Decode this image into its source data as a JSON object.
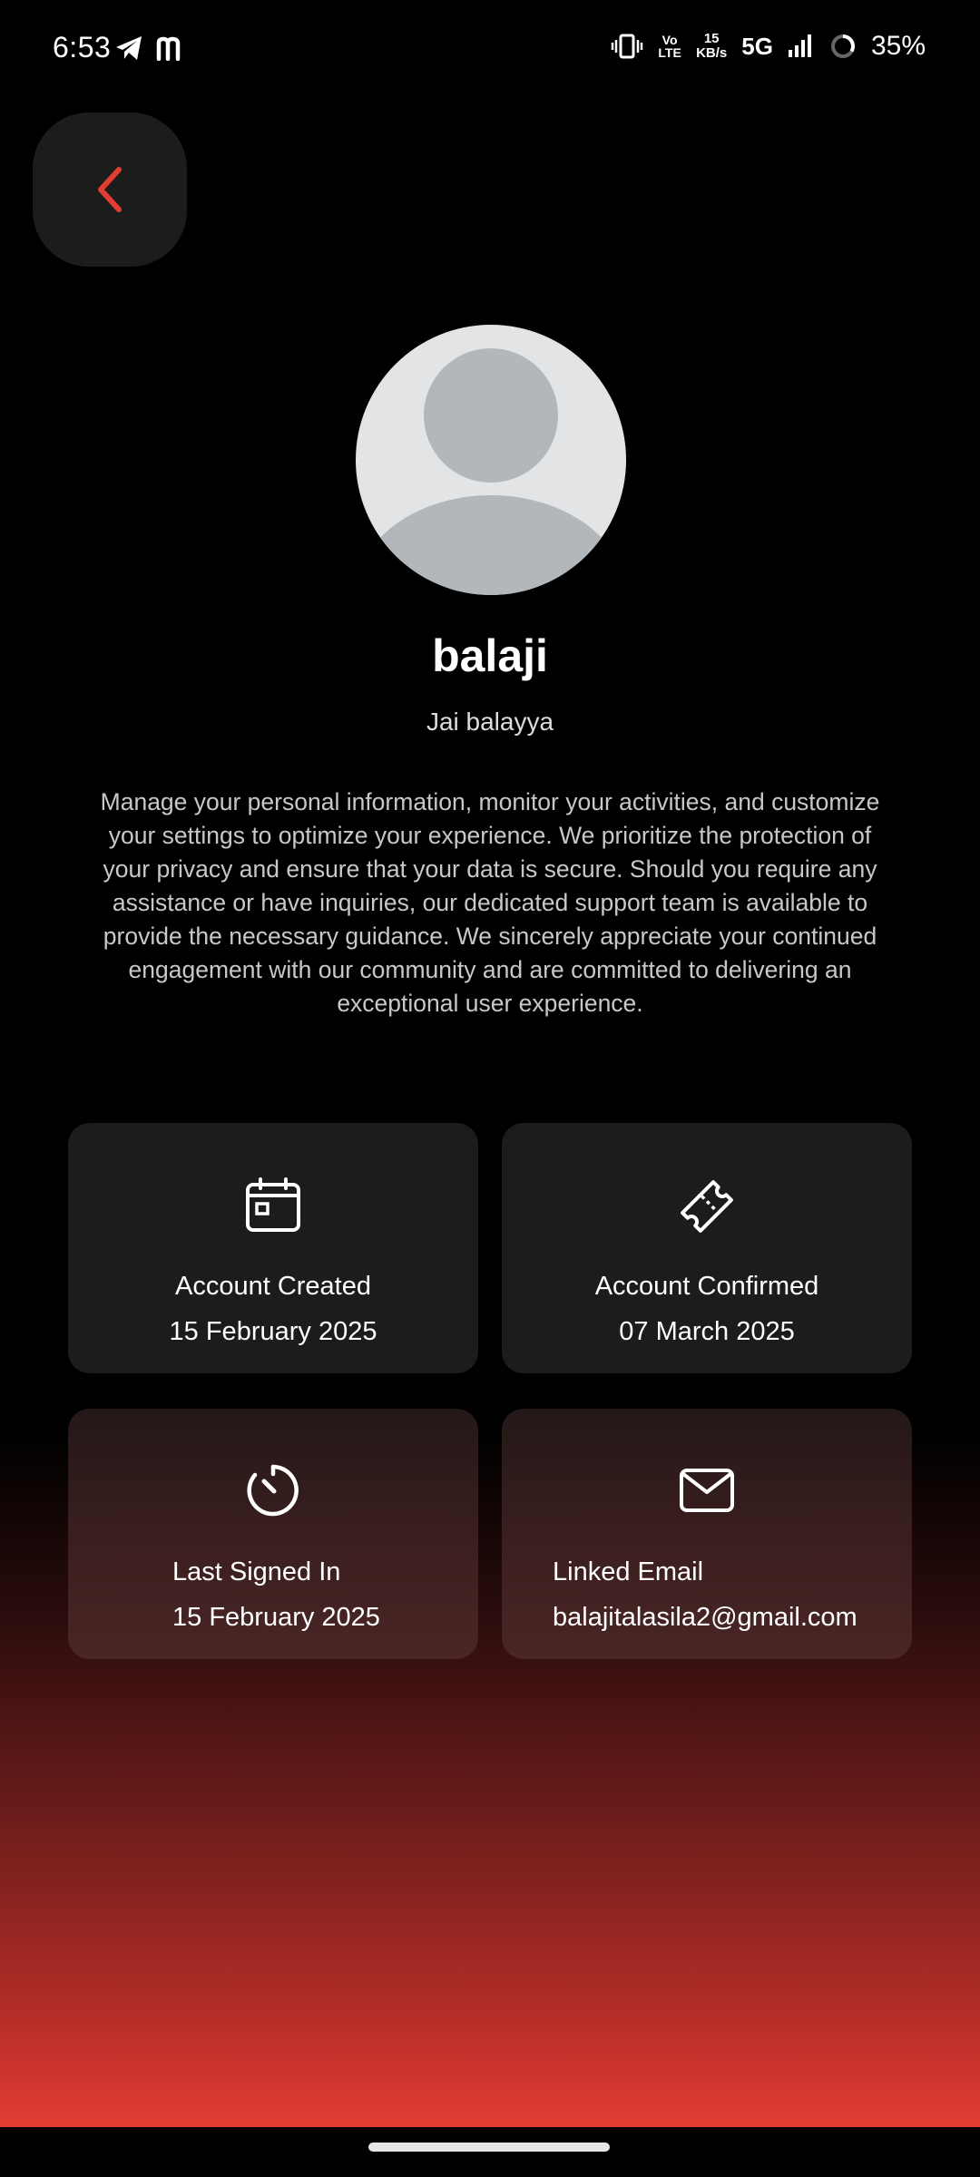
{
  "status_bar": {
    "time": "6:53",
    "kbs_value": "15",
    "kbs_unit": "KB/s",
    "network": "5G",
    "volte": "Vo LTE",
    "battery": "35%"
  },
  "profile": {
    "name": "balaji",
    "tagline": "Jai balayya",
    "description": "Manage your personal information, monitor your activities, and customize your settings to optimize your experience. We prioritize the protection of your privacy and ensure that your data is secure. Should you require any assistance or have inquiries, our dedicated support team is available to provide the necessary guidance. We sincerely appreciate your continued engagement with our community and are committed to delivering an exceptional user experience."
  },
  "cards": {
    "account_created": {
      "icon": "calendar-icon",
      "title": "Account Created",
      "value": "15 February 2025"
    },
    "account_confirmed": {
      "icon": "ticket-icon",
      "title": "Account Confirmed",
      "value": "07 March 2025"
    },
    "last_signed_in": {
      "icon": "timer-icon",
      "title": "Last Signed In",
      "value": "15 February 2025"
    },
    "linked_email": {
      "icon": "mail-icon",
      "title": "Linked Email",
      "value": "balajitalasila2@gmail.com"
    }
  },
  "colors": {
    "accent": "#e23d33",
    "card_bg": "#1c1c1c",
    "background": "#000000"
  }
}
